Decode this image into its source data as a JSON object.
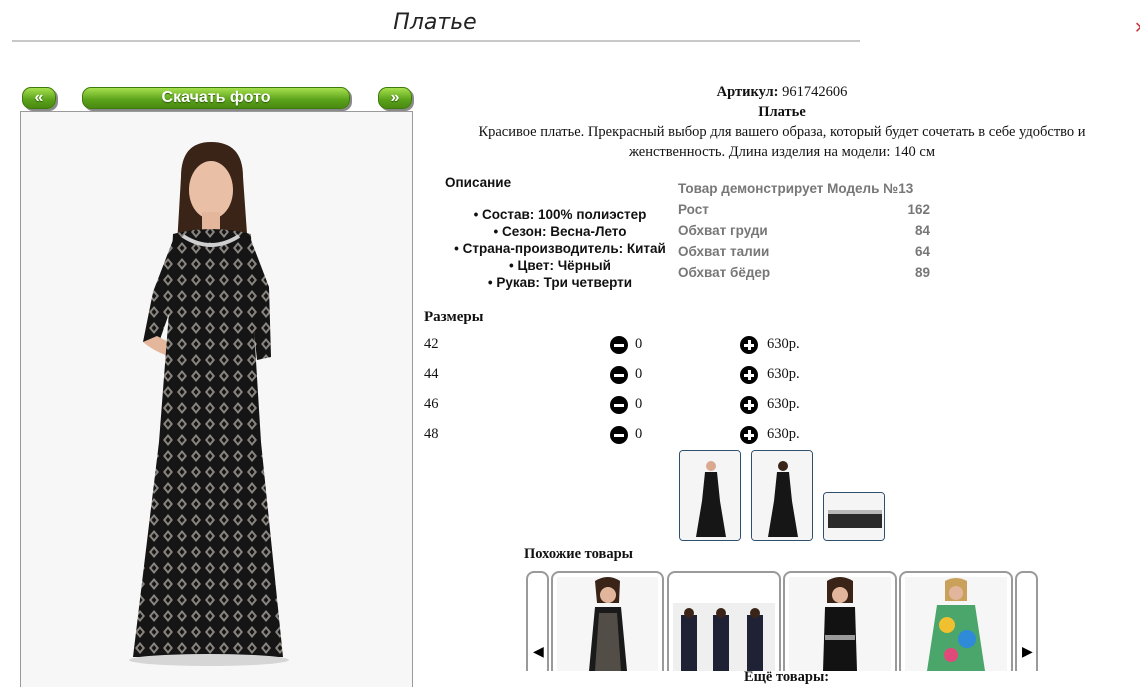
{
  "page": {
    "title": "Платье"
  },
  "gallery": {
    "prev_label": "«",
    "download_label": "Скачать фото",
    "next_label": "»"
  },
  "product": {
    "article_label": "Артикул:",
    "article_value": "961742606",
    "name": "Платье",
    "description_line1": "Красивое платье. Прекрасный выбор для вашего образа, который будет сочетать в себе удобство и",
    "description_line2": "женственность. Длина изделия на модели: 140 см"
  },
  "details": {
    "heading": "Описание",
    "items": [
      "Состав: 100% полиэстер",
      "Сезон: Весна-Лето",
      "Страна-производитель: Китай",
      "Цвет: Чёрный",
      "Рукав: Три четверти"
    ]
  },
  "model": {
    "title": "Товар демонстрирует Модель №13",
    "rows": [
      {
        "label": "Рост",
        "value": "162"
      },
      {
        "label": "Обхват груди",
        "value": "84"
      },
      {
        "label": "Обхват талии",
        "value": "64"
      },
      {
        "label": "Обхват бёдер",
        "value": "89"
      }
    ]
  },
  "sizes": {
    "heading": "Размеры",
    "rows": [
      {
        "size": "42",
        "qty": "0",
        "price": "630р."
      },
      {
        "size": "44",
        "qty": "0",
        "price": "630р."
      },
      {
        "size": "46",
        "qty": "0",
        "price": "630р."
      },
      {
        "size": "48",
        "qty": "0",
        "price": "630р."
      }
    ]
  },
  "similar": {
    "heading": "Похожие товары",
    "prev_icon": "◀",
    "next_icon": "▶"
  },
  "more": {
    "heading": "Ещё товары:"
  },
  "colors": {
    "button_green": "#5aa11a",
    "thumb_border": "#2f4f6f",
    "muted_text": "#777777",
    "dress": "#141414"
  }
}
